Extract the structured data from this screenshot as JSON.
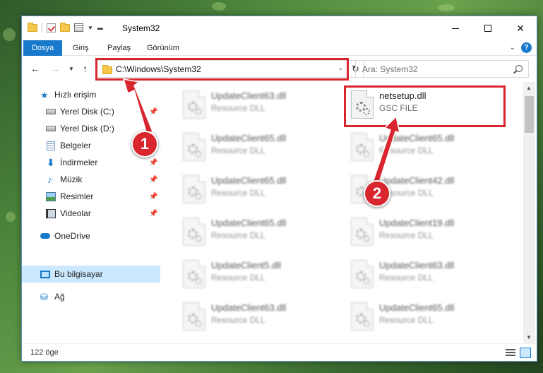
{
  "window": {
    "title": "System32"
  },
  "ribbon": {
    "tabs": [
      {
        "label": "Dosya",
        "active": true
      },
      {
        "label": "Giriş",
        "active": false
      },
      {
        "label": "Paylaş",
        "active": false
      },
      {
        "label": "Görünüm",
        "active": false
      }
    ],
    "help": "?"
  },
  "navbar": {
    "address": "C:\\Windows\\System32",
    "search_placeholder": "Ara: System32"
  },
  "sidebar": {
    "items": [
      {
        "label": "Hızlı erişim",
        "icon": "star-icon",
        "pinned": false
      },
      {
        "label": "Yerel Disk (C:)",
        "icon": "disk-icon",
        "pinned": true
      },
      {
        "label": "Yerel Disk (D:)",
        "icon": "disk-icon",
        "pinned": true
      },
      {
        "label": "Belgeler",
        "icon": "document-icon",
        "pinned": true
      },
      {
        "label": "İndirmeler",
        "icon": "download-icon",
        "pinned": true
      },
      {
        "label": "Müzik",
        "icon": "music-icon",
        "pinned": true
      },
      {
        "label": "Resimler",
        "icon": "picture-icon",
        "pinned": true
      },
      {
        "label": "Videolar",
        "icon": "video-icon",
        "pinned": true
      },
      {
        "label": "OneDrive",
        "icon": "cloud-icon",
        "pinned": false
      },
      {
        "label": "Bu bilgisayar",
        "icon": "computer-icon",
        "pinned": false,
        "selected": true
      },
      {
        "label": "Ağ",
        "icon": "network-icon",
        "pinned": false
      }
    ]
  },
  "files": {
    "left_column": [
      {
        "name": "UpdateClient63.dll",
        "type": "Resource DLL"
      },
      {
        "name": "UpdateClient65.dll",
        "type": "Resource DLL"
      },
      {
        "name": "UpdateClient65.dll",
        "type": "Resource DLL"
      },
      {
        "name": "UpdateClient65.dll",
        "type": "Resource DLL"
      },
      {
        "name": "UpdateClient5.dll",
        "type": "Resource DLL"
      },
      {
        "name": "UpdateClient63.dll",
        "type": "Resource DLL"
      }
    ],
    "right_column": [
      {
        "name": "netsetup.dll",
        "type": "GSC FILE"
      },
      {
        "name": "UpdateClient65.dll",
        "type": "Resource DLL"
      },
      {
        "name": "UpdateClient42.dll",
        "type": "Resource DLL"
      },
      {
        "name": "UpdateClient19.dll",
        "type": "Resource DLL"
      },
      {
        "name": "UpdateClient63.dll",
        "type": "Resource DLL"
      },
      {
        "name": "UpdateClient65.dll",
        "type": "Resource DLL"
      }
    ]
  },
  "status": {
    "item_count": "122 öge"
  },
  "callouts": {
    "one": "1",
    "two": "2"
  },
  "colors": {
    "accent": "#1979ca",
    "highlight": "#d9262e",
    "selected_bg": "#cce8ff"
  }
}
